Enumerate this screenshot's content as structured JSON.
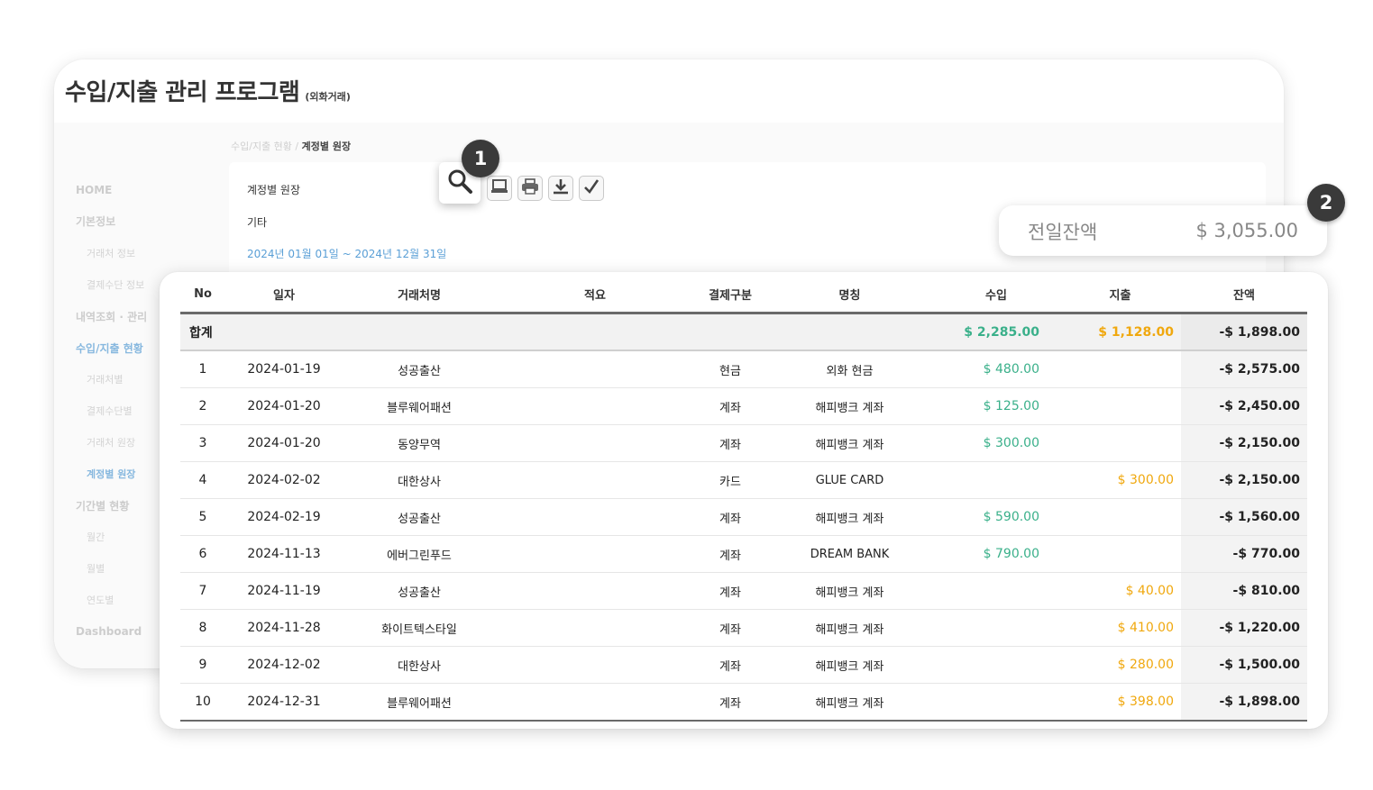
{
  "app": {
    "title": "수입/지출 관리 프로그램",
    "subtitle": "(외화거래)"
  },
  "sidebar": {
    "items": [
      {
        "label": "HOME",
        "kind": "main"
      },
      {
        "label": "기본정보",
        "kind": "main"
      },
      {
        "label": "거래처 정보",
        "kind": "sub"
      },
      {
        "label": "결제수단 정보",
        "kind": "sub"
      },
      {
        "label": "내역조회 · 관리",
        "kind": "main"
      },
      {
        "label": "수입/지출 현황",
        "kind": "main-active"
      },
      {
        "label": "거래처별",
        "kind": "sub"
      },
      {
        "label": "결제수단별",
        "kind": "sub"
      },
      {
        "label": "거래처 원장",
        "kind": "sub"
      },
      {
        "label": "계정별 원장",
        "kind": "sub-active"
      },
      {
        "label": "기간별 현황",
        "kind": "main"
      },
      {
        "label": "월간",
        "kind": "sub"
      },
      {
        "label": "월별",
        "kind": "sub"
      },
      {
        "label": "연도별",
        "kind": "sub"
      },
      {
        "label": "Dashboard",
        "kind": "main"
      }
    ]
  },
  "breadcrumb": {
    "parent": "수입/지출 현황",
    "separator": " / ",
    "current": "계정별 원장"
  },
  "panel": {
    "account_name": "계정별 원장",
    "category": "기타",
    "date_range": "2024년 01월 01일 ~ 2024년 12월 31일"
  },
  "toolbar": {
    "icons": [
      "search-icon",
      "laptop-icon",
      "print-icon",
      "download-icon",
      "check-icon"
    ]
  },
  "badges": {
    "one": "1",
    "two": "2"
  },
  "balance_card": {
    "label": "전일잔액",
    "value": "$ 3,055.00"
  },
  "colors": {
    "income": "#3ab08a",
    "expense": "#f0a80e",
    "active_nav": "#2a83c9",
    "badge": "#3a3a3a"
  },
  "table": {
    "headers": {
      "no": "No",
      "date": "일자",
      "vendor": "거래처명",
      "memo": "적요",
      "payment_type": "결제구분",
      "name": "명칭",
      "income": "수입",
      "expense": "지출",
      "balance": "잔액"
    },
    "total": {
      "label": "합계",
      "income": "$ 2,285.00",
      "expense": "$ 1,128.00",
      "balance": "-$ 1,898.00"
    },
    "rows": [
      {
        "no": "1",
        "date": "2024-01-19",
        "vendor": "성공출산",
        "memo": "",
        "payment_type": "현금",
        "name": "외화 현금",
        "income": "$ 480.00",
        "expense": "",
        "balance": "-$ 2,575.00"
      },
      {
        "no": "2",
        "date": "2024-01-20",
        "vendor": "블루웨어패션",
        "memo": "",
        "payment_type": "계좌",
        "name": "해피뱅크 계좌",
        "income": "$ 125.00",
        "expense": "",
        "balance": "-$ 2,450.00"
      },
      {
        "no": "3",
        "date": "2024-01-20",
        "vendor": "동양무역",
        "memo": "",
        "payment_type": "계좌",
        "name": "해피뱅크 계좌",
        "income": "$ 300.00",
        "expense": "",
        "balance": "-$ 2,150.00"
      },
      {
        "no": "4",
        "date": "2024-02-02",
        "vendor": "대한상사",
        "memo": "",
        "payment_type": "카드",
        "name": "GLUE CARD",
        "income": "",
        "expense": "$ 300.00",
        "balance": "-$ 2,150.00"
      },
      {
        "no": "5",
        "date": "2024-02-19",
        "vendor": "성공출산",
        "memo": "",
        "payment_type": "계좌",
        "name": "해피뱅크 계좌",
        "income": "$ 590.00",
        "expense": "",
        "balance": "-$ 1,560.00"
      },
      {
        "no": "6",
        "date": "2024-11-13",
        "vendor": "에버그린푸드",
        "memo": "",
        "payment_type": "계좌",
        "name": "DREAM BANK",
        "income": "$ 790.00",
        "expense": "",
        "balance": "-$ 770.00"
      },
      {
        "no": "7",
        "date": "2024-11-19",
        "vendor": "성공출산",
        "memo": "",
        "payment_type": "계좌",
        "name": "해피뱅크 계좌",
        "income": "",
        "expense": "$ 40.00",
        "balance": "-$ 810.00"
      },
      {
        "no": "8",
        "date": "2024-11-28",
        "vendor": "화이트텍스타일",
        "memo": "",
        "payment_type": "계좌",
        "name": "해피뱅크 계좌",
        "income": "",
        "expense": "$ 410.00",
        "balance": "-$ 1,220.00"
      },
      {
        "no": "9",
        "date": "2024-12-02",
        "vendor": "대한상사",
        "memo": "",
        "payment_type": "계좌",
        "name": "해피뱅크 계좌",
        "income": "",
        "expense": "$ 280.00",
        "balance": "-$ 1,500.00"
      },
      {
        "no": "10",
        "date": "2024-12-31",
        "vendor": "블루웨어패션",
        "memo": "",
        "payment_type": "계좌",
        "name": "해피뱅크 계좌",
        "income": "",
        "expense": "$ 398.00",
        "balance": "-$ 1,898.00"
      }
    ]
  }
}
